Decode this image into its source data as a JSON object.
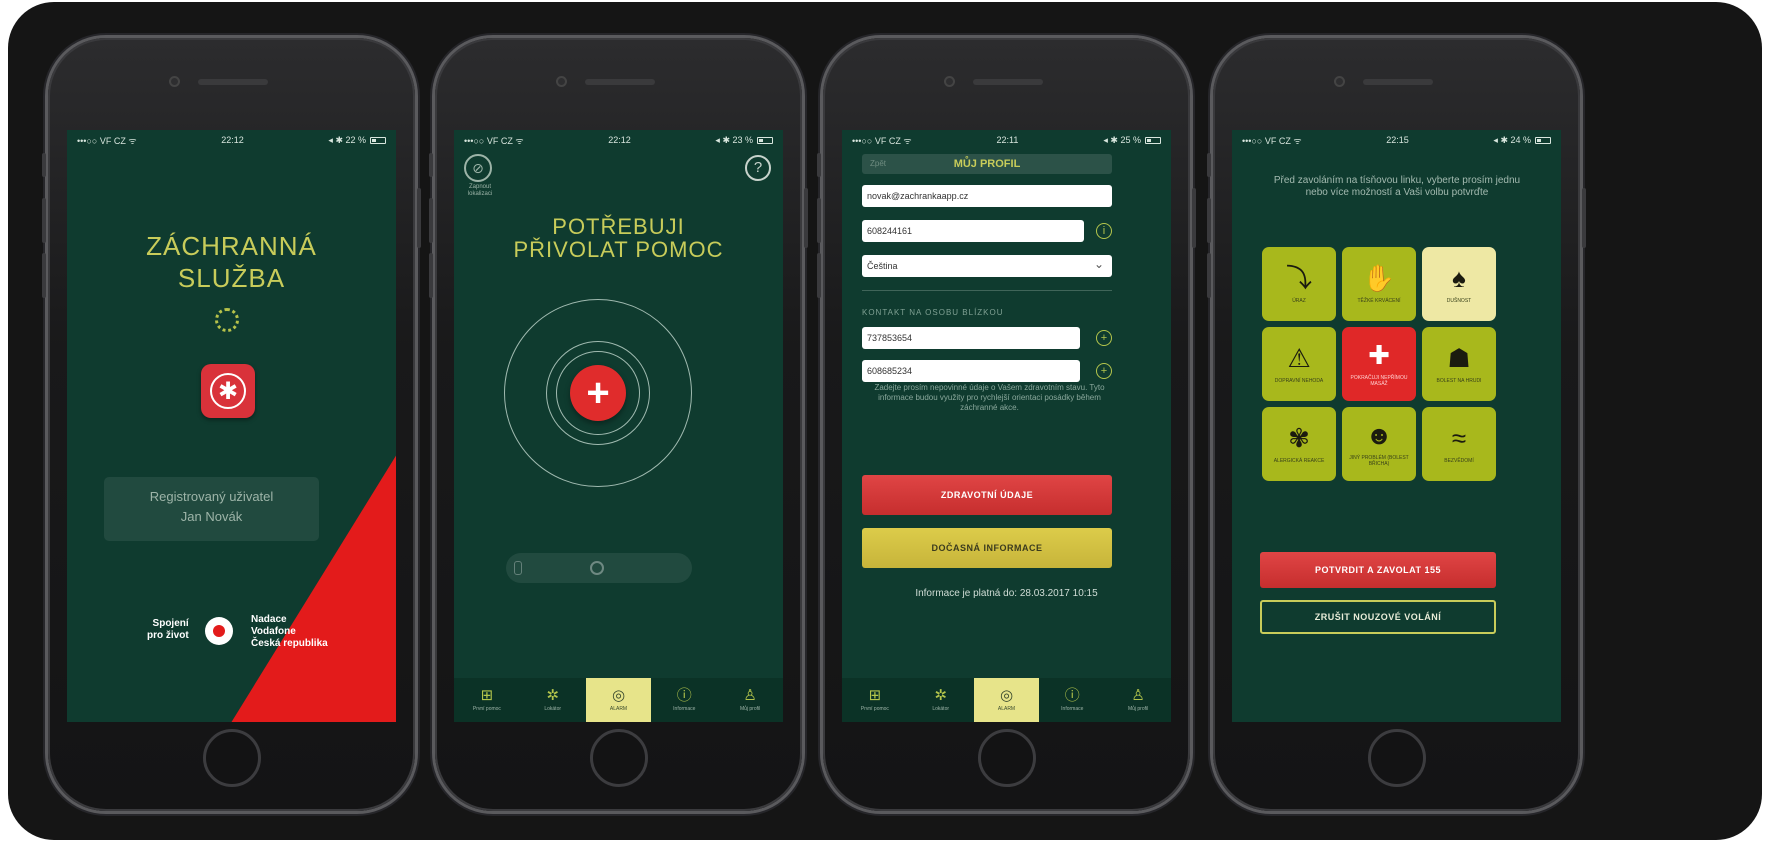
{
  "status": {
    "p1": {
      "carrier": "•••○○ VF CZ ᯤ",
      "time": "22:12",
      "battery": "◂ ✱ 22 %"
    },
    "p2": {
      "carrier": "•••○○ VF CZ ᯤ",
      "time": "22:12",
      "battery": "◂ ✱ 23 %"
    },
    "p3": {
      "carrier": "•••○○ VF CZ ᯤ",
      "time": "22:11",
      "battery": "◂ ✱ 25 %"
    },
    "p4": {
      "carrier": "•••○○ VF CZ ᯤ",
      "time": "22:15",
      "battery": "◂ ✱ 24 %"
    }
  },
  "screen1": {
    "title_line1": "ZÁCHRANNÁ",
    "title_line2": "SLUŽBA",
    "user_label": "Registrovaný uživatel",
    "user_name": "Jan Novák",
    "partner_left_1": "Spojení",
    "partner_left_2": "pro život",
    "partner_right_1": "Nadace",
    "partner_right_2": "Vodafone",
    "partner_right_3": "Česká republika",
    "logo_icon": "star-of-life-icon"
  },
  "screen2": {
    "compass_label": "Zapnout lokalizaci",
    "title_line1": "POTŘEBUJI",
    "title_line2": "PŘIVOLAT POMOC",
    "help": "?",
    "cross": "+"
  },
  "tabs": [
    {
      "icon": "first-aid-icon",
      "glyph": "⊞",
      "label": "První pomoc"
    },
    {
      "icon": "location-icon",
      "glyph": "✲",
      "label": "Lokátor"
    },
    {
      "icon": "alarm-icon",
      "glyph": "◎",
      "label": "ALARM"
    },
    {
      "icon": "info-icon",
      "glyph": "ⓘ",
      "label": "Informace"
    },
    {
      "icon": "profile-icon",
      "glyph": "♙",
      "label": "Můj profil"
    }
  ],
  "screen3": {
    "header_aside": "Zpět",
    "header": "MŮJ PROFIL",
    "email": "novak@zachrankaapp.cz",
    "phone": "608244161",
    "language": "Čeština",
    "contact_label": "KONTAKT NA OSOBU BLÍZKOU",
    "contact1": "737853654",
    "contact2": "608685234",
    "note": "Zadejte prosím nepovinné údaje o Vašem zdravotním stavu. Tyto informace budou využity pro rychlejší orientaci posádky během záchranné akce.",
    "btn_health": "ZDRAVOTNÍ ÚDAJE",
    "btn_temp": "DOČASNÁ INFORMACE",
    "valid_until": "Informace je platná do: 28.03.2017 10:15"
  },
  "screen4": {
    "intro": "Před zavoláním na tísňovou linku, vyberte prosím jednu nebo více možností a Vaši volbu potvrďte",
    "tiles": [
      {
        "name": "tile-fall",
        "icon": "fall-icon",
        "glyph": "⤵",
        "label": "ÚRAZ",
        "style": "normal"
      },
      {
        "name": "tile-bleeding",
        "icon": "bleeding-icon",
        "glyph": "✋",
        "label": "TĚŽKÉ KRVÁCENÍ",
        "style": "normal"
      },
      {
        "name": "tile-breathing",
        "icon": "lungs-icon",
        "glyph": "♠",
        "label": "DUŠNOST",
        "style": "light"
      },
      {
        "name": "tile-traffic",
        "icon": "car-crash-icon",
        "glyph": "⚠",
        "label": "DOPRAVNÍ NEHODA",
        "style": "normal"
      },
      {
        "name": "tile-cpr",
        "icon": "cpr-icon",
        "glyph": "✚",
        "label": "POKRAČUJI NEPŘÍMOU MASÁŽ",
        "style": "red"
      },
      {
        "name": "tile-chest-pain",
        "icon": "chest-pain-icon",
        "glyph": "☗",
        "label": "BOLEST NA HRUDI",
        "style": "normal"
      },
      {
        "name": "tile-allergy",
        "icon": "allergy-icon",
        "glyph": "✾",
        "label": "ALERGICKÁ REAKCE",
        "style": "normal"
      },
      {
        "name": "tile-other",
        "icon": "person-icon",
        "glyph": "☻",
        "label": "JINÝ PROBLÉM (BOLEST BŘICHA)",
        "style": "normal"
      },
      {
        "name": "tile-unconscious",
        "icon": "unconscious-icon",
        "glyph": "≈",
        "label": "BEZVĚDOMÍ",
        "style": "normal"
      }
    ],
    "btn_confirm": "POTVRDIT A ZAVOLAT 155",
    "btn_cancel": "ZRUŠIT NOUZOVÉ VOLÁNÍ"
  },
  "colors": {
    "screen_bg": "#0f3b2f",
    "accent_yellow": "#c8cc5a",
    "emergency_red": "#e02828",
    "tile_green": "#a8b81c",
    "vodafone_red": "#e31b1b"
  }
}
